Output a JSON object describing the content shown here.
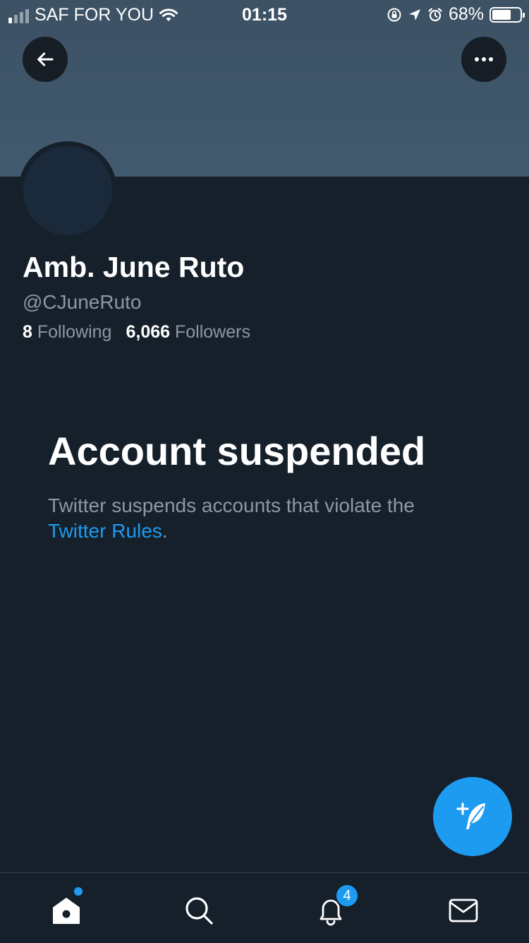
{
  "status_bar": {
    "carrier": "SAF FOR YOU",
    "time": "01:15",
    "battery_percent": "68%",
    "battery_level": 0.68,
    "signal_bars": 4,
    "signal_bars_filled": 1,
    "icons": [
      "wifi-icon",
      "orientation-lock-icon",
      "location-icon",
      "alarm-icon",
      "battery-icon"
    ]
  },
  "header": {
    "back_icon": "arrow-left-icon",
    "more_icon": "more-horizontal-icon"
  },
  "profile": {
    "name": "Amb. June Ruto",
    "handle": "@CJuneRuto",
    "following_count": "8",
    "following_label": "Following",
    "followers_count": "6,066",
    "followers_label": "Followers"
  },
  "suspension": {
    "title": "Account suspended",
    "text": "Twitter suspends accounts that violate the",
    "link": "Twitter Rules",
    "suffix": "."
  },
  "fab": {
    "icon": "compose-tweet-icon"
  },
  "bottom_nav": {
    "items": [
      {
        "icon": "home-icon",
        "has_dot": true
      },
      {
        "icon": "search-icon"
      },
      {
        "icon": "notifications-icon",
        "badge": "4"
      },
      {
        "icon": "messages-icon"
      }
    ]
  },
  "colors": {
    "background": "#15202b",
    "banner": "#3d5265",
    "accent": "#1d9bf0",
    "secondary_text": "#8b98a5"
  }
}
